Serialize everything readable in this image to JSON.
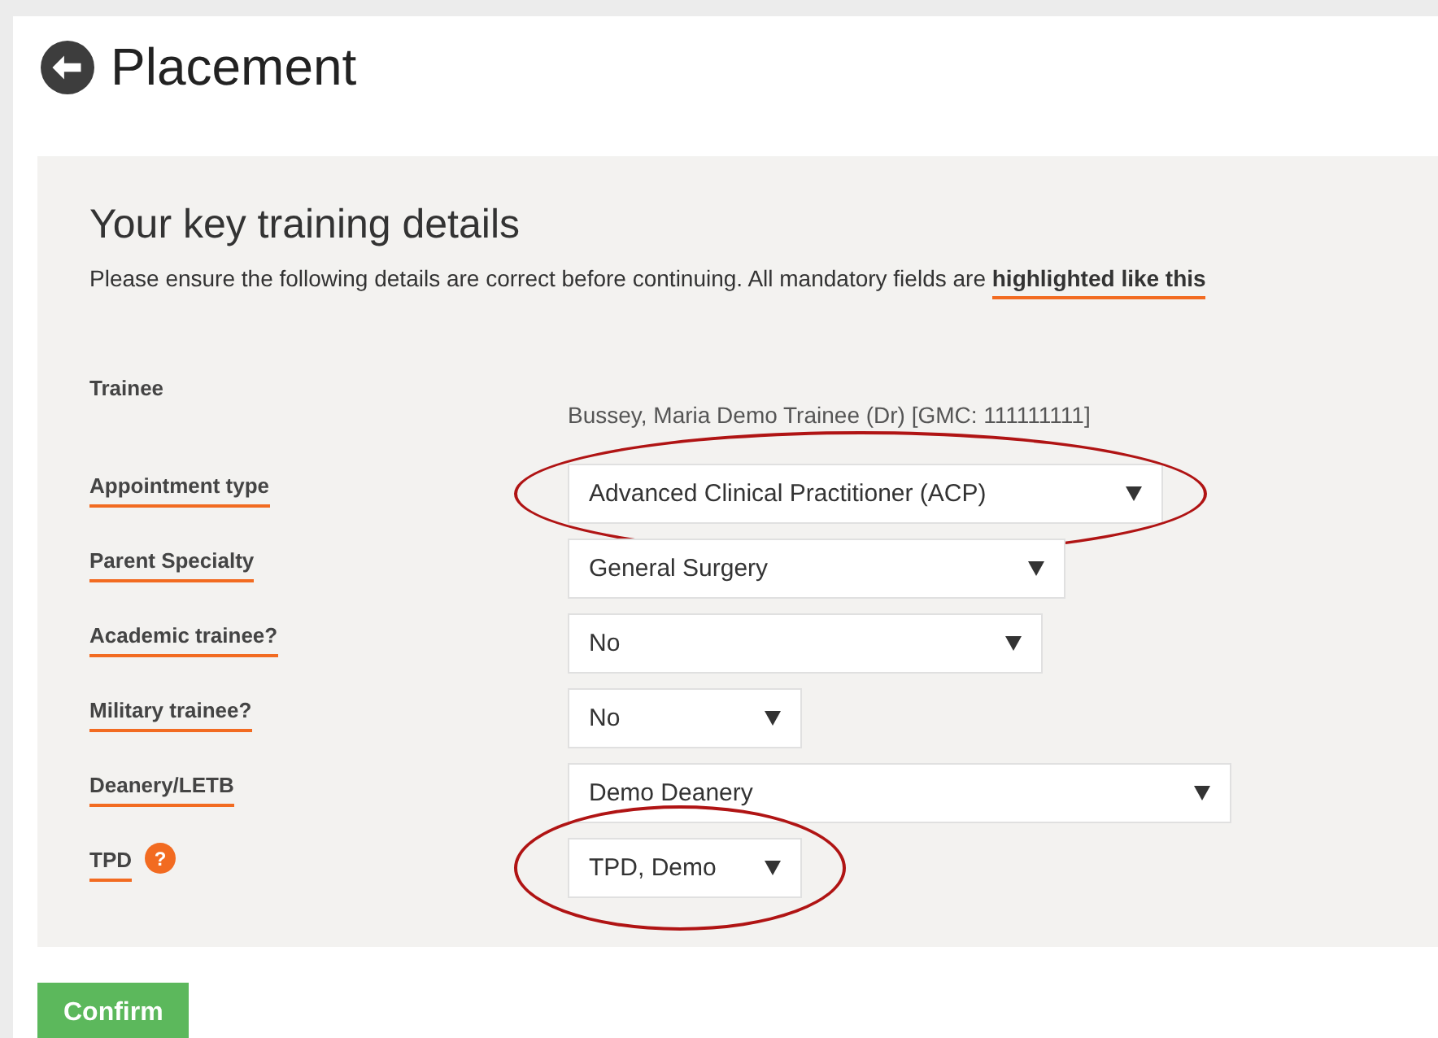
{
  "page": {
    "title": "Placement"
  },
  "panel": {
    "heading": "Your key training details",
    "intro": "Please ensure the following details are correct before continuing. All mandatory fields are ",
    "intro_highlight": "highlighted like this"
  },
  "fields": [
    {
      "kind": "text",
      "label": "Trainee",
      "mandatory": false,
      "value": "Bussey, Maria Demo Trainee (Dr) [GMC: 111111111]"
    },
    {
      "kind": "select",
      "label": "Appointment type",
      "mandatory": true,
      "value": "Advanced Clinical Practitioner (ACP)",
      "circled": true
    },
    {
      "kind": "select",
      "label": "Parent Specialty",
      "mandatory": true,
      "value": "General Surgery",
      "circled": false
    },
    {
      "kind": "select",
      "label": "Academic trainee?",
      "mandatory": true,
      "value": "No",
      "circled": false
    },
    {
      "kind": "select",
      "label": "Military trainee?",
      "mandatory": true,
      "value": "No",
      "circled": false
    },
    {
      "kind": "select",
      "label": "Deanery/LETB",
      "mandatory": true,
      "value": "Demo Deanery",
      "circled": false
    },
    {
      "kind": "select",
      "label": "TPD",
      "mandatory": true,
      "value": "TPD, Demo",
      "circled": true,
      "help": "?"
    }
  ],
  "buttons": [
    {
      "label": "Confirm"
    }
  ]
}
